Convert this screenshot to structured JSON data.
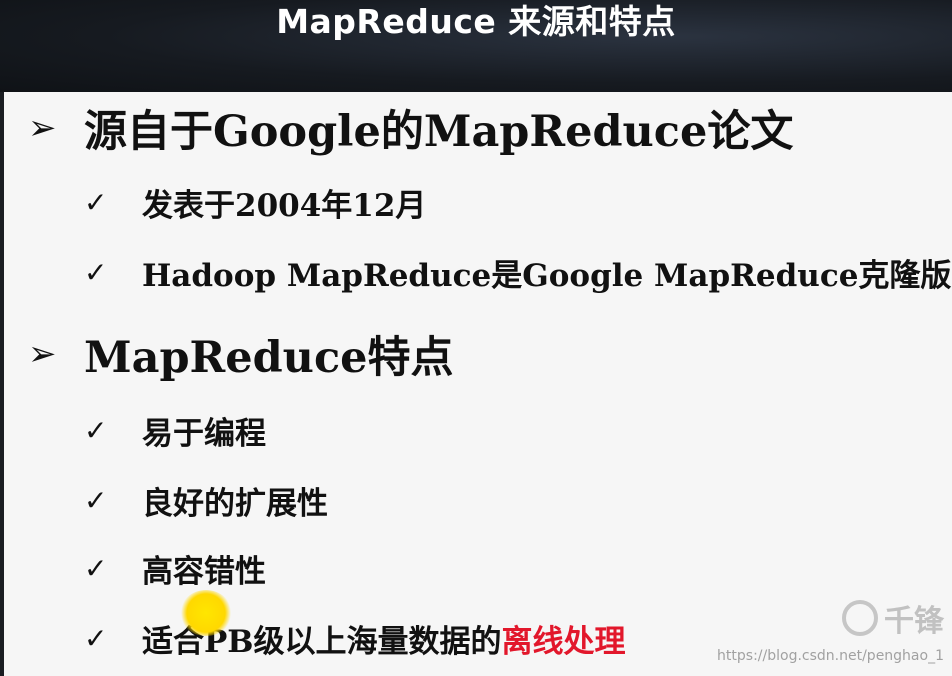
{
  "title": "MapReduce 来源和特点",
  "sections": [
    {
      "heading": "源自于Google的MapReduce论文",
      "items": [
        "发表于2004年12月",
        "Hadoop MapReduce是Google MapReduce克隆版"
      ]
    },
    {
      "heading": "MapReduce特点",
      "items": [
        "易于编程",
        "良好的扩展性",
        "高容错性"
      ],
      "last_item": {
        "prefix": "适合PB级以上海量数据的",
        "highlight": "离线处理"
      }
    }
  ],
  "bullets": {
    "level1": "➢",
    "level2": "✓"
  },
  "watermark": {
    "brand": "千锋",
    "url": "https://blog.csdn.net/penghao_1"
  },
  "colors": {
    "highlight": "#e2172b",
    "slide_bg": "#f6f6f6",
    "title": "#ffffff"
  }
}
